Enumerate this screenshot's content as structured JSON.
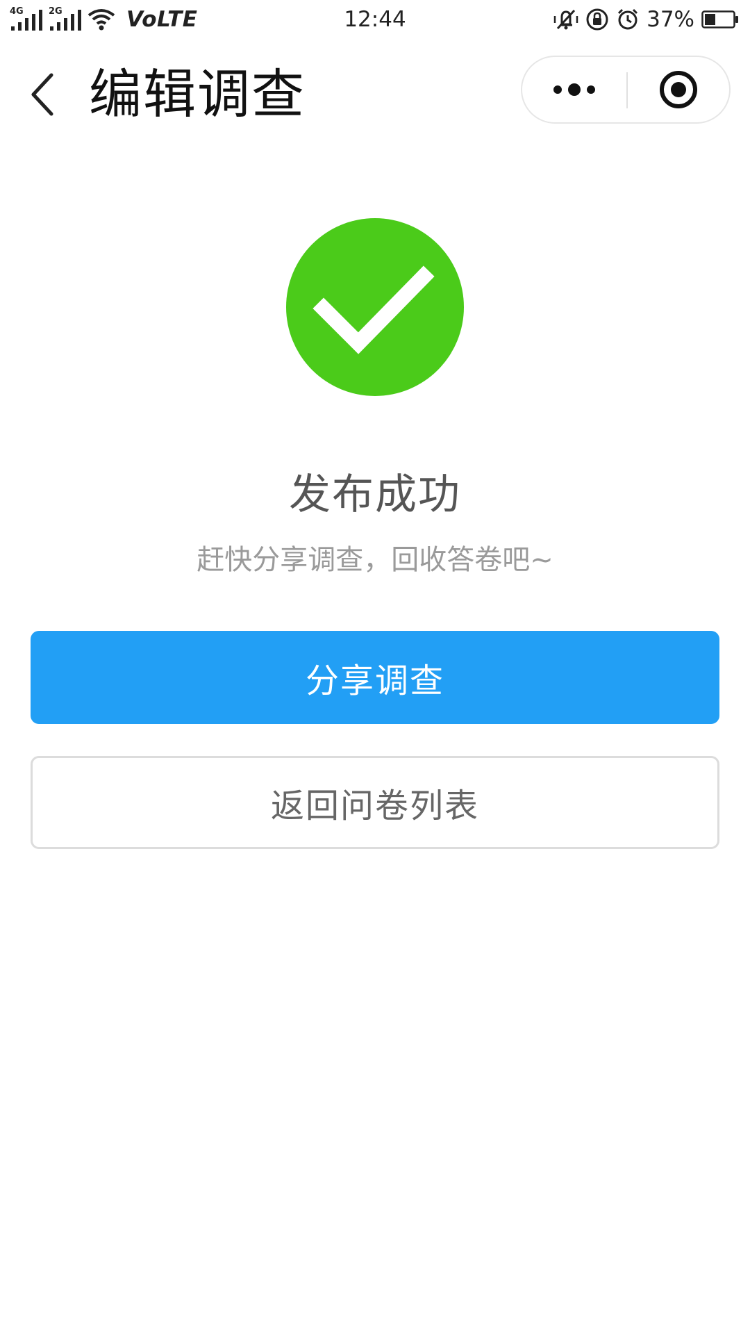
{
  "status_bar": {
    "network_1": "4G",
    "network_2": "2G",
    "volte": "VoLTE",
    "time": "12:44",
    "battery_percent": "37%",
    "battery_level": 0.37,
    "icons": [
      "signal-icon",
      "wifi-icon",
      "silent-vibrate-icon",
      "rotation-lock-icon",
      "alarm-icon",
      "battery-icon"
    ]
  },
  "nav": {
    "title": "编辑调查",
    "back_icon": "chevron-left-icon",
    "capsule_menu_icon": "more-dots-icon",
    "capsule_close_icon": "target-circle-icon"
  },
  "result": {
    "icon": "success-check-icon",
    "icon_color": "#4bcb1a",
    "title": "发布成功",
    "subtitle": "赶快分享调查，回收答卷吧~"
  },
  "actions": {
    "share_label": "分享调查",
    "share_color": "#229ff5",
    "back_list_label": "返回问卷列表"
  }
}
